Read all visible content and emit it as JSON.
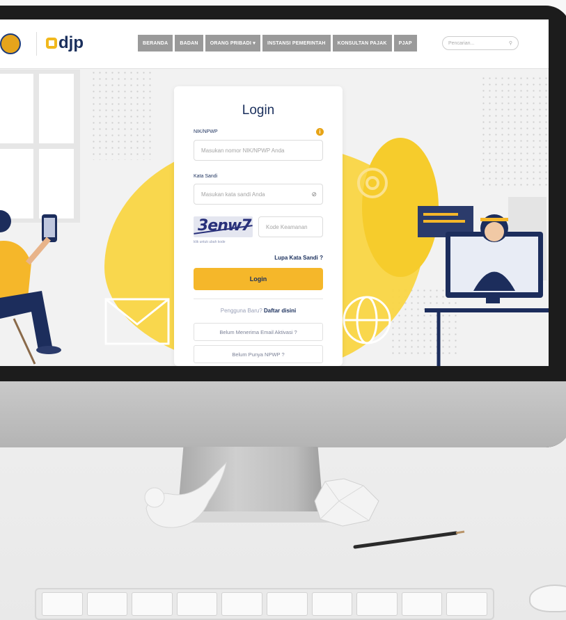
{
  "nav": {
    "logo_text": "djp",
    "menu": [
      {
        "label": "BERANDA"
      },
      {
        "label": "BADAN"
      },
      {
        "label": "ORANG PRIBADI ▾"
      },
      {
        "label": "INSTANSI PEMERINTAH"
      },
      {
        "label": "KONSULTAN PAJAK"
      },
      {
        "label": "PJAP"
      }
    ],
    "search_placeholder": "Pencarian..."
  },
  "login": {
    "title": "Login",
    "nik_label": "NIK/NPWP",
    "nik_placeholder": "Masukan nomor NIK/NPWP Anda",
    "password_label": "Kata Sandi",
    "password_placeholder": "Masukan kata sandi Anda",
    "captcha_text": "3enw7",
    "captcha_placeholder": "Kode Keamanan",
    "captcha_hint": "klik untuk ubah kode",
    "forgot_link": "Lupa Kata Sandi ?",
    "submit_label": "Login",
    "register_prefix": "Pengguna Baru?",
    "register_link": "Daftar disini",
    "activation_button": "Belum Menerima Email Aktivasi ?",
    "npwp_button": "Belum Punya NPWP ?"
  },
  "colors": {
    "brand_navy": "#1a2f5c",
    "accent_yellow": "#f5b72a",
    "menu_gray": "#9a9a9a"
  }
}
